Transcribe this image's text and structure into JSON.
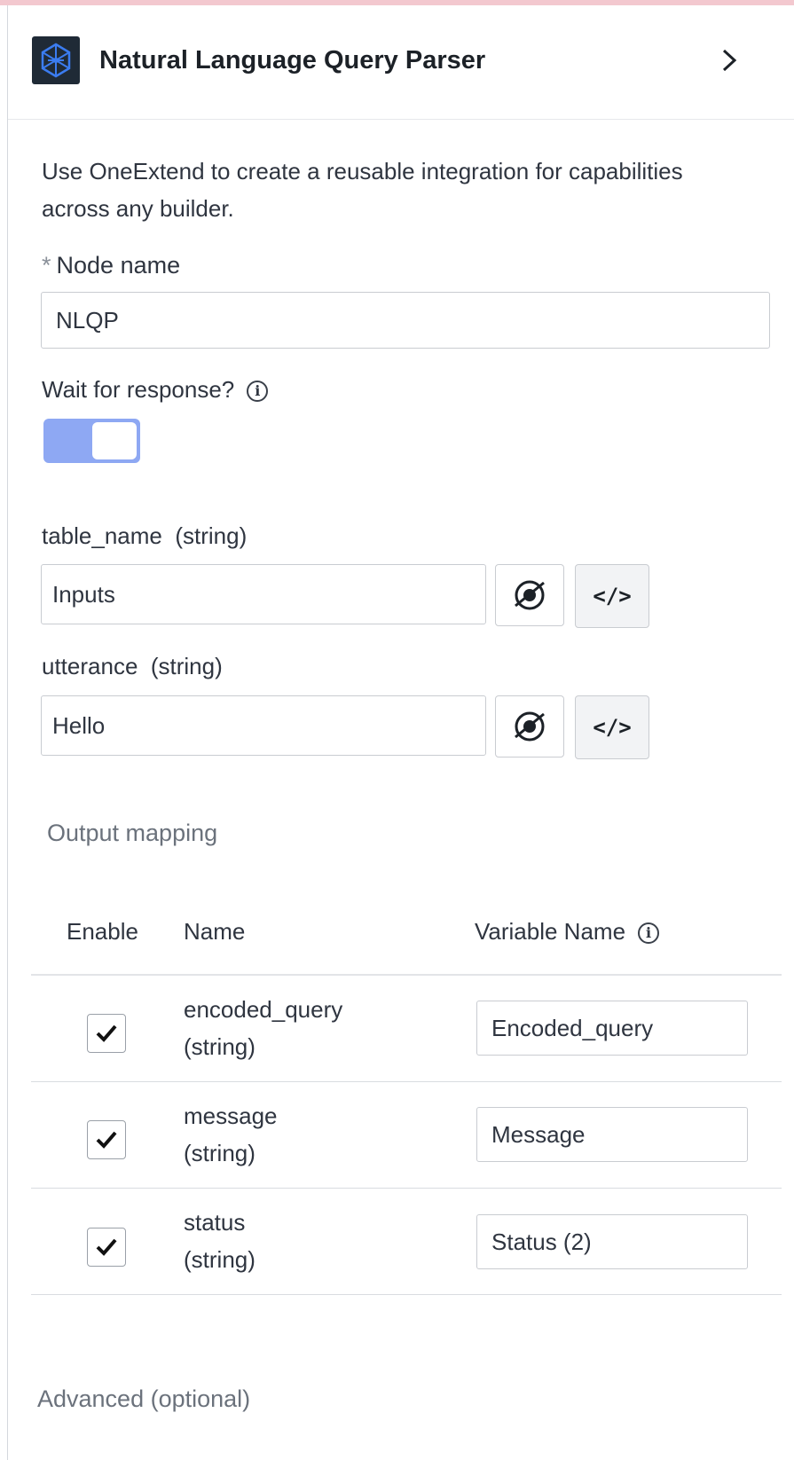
{
  "header": {
    "title": "Natural Language Query Parser",
    "logo_icon": "hexagon-network-icon",
    "collapse_icon": "chevron-right-icon"
  },
  "description": "Use OneExtend to create a reusable integration for capabilities across any builder.",
  "node_name": {
    "required_mark": "*",
    "label": "Node name",
    "value": "NLQP"
  },
  "wait_for_response": {
    "label": "Wait for response?",
    "enabled": true,
    "info_icon": "info-icon"
  },
  "inputs": [
    {
      "name": "table_name",
      "type": "(string)",
      "value": "Inputs"
    },
    {
      "name": "utterance",
      "type": "(string)",
      "value": "Hello"
    }
  ],
  "output_mapping": {
    "title": "Output mapping",
    "columns": {
      "enable": "Enable",
      "name": "Name",
      "variable_name": "Variable Name"
    },
    "rows": [
      {
        "checked": true,
        "name": "encoded_query",
        "type": "(string)",
        "variable": "Encoded_query"
      },
      {
        "checked": true,
        "name": "message",
        "type": "(string)",
        "variable": "Message"
      },
      {
        "checked": true,
        "name": "status",
        "type": "(string)",
        "variable": "Status (2)"
      }
    ]
  },
  "advanced": {
    "label": "Advanced (optional)"
  },
  "colors": {
    "toggle_on": "#8ea8f3",
    "logo_bg": "#1f2a36",
    "logo_accent": "#3b7cf0"
  }
}
